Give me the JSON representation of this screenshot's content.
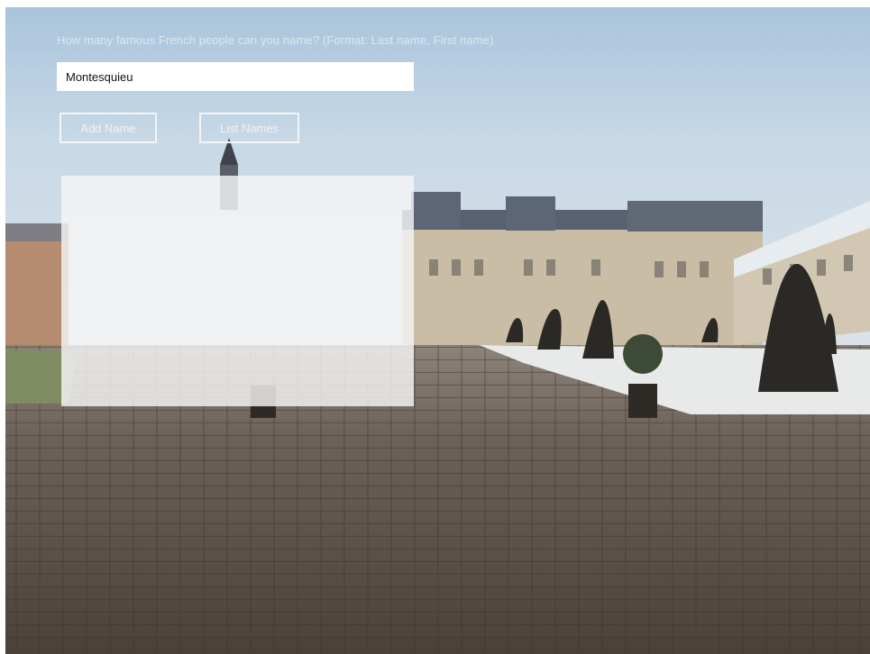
{
  "form": {
    "prompt": "How many famous French people  can you name? (Format: Last name, First name)",
    "name_value": "Montesquieu",
    "add_label": "Add Name",
    "list_label": "List Names"
  },
  "results": {
    "items": []
  },
  "colors": {
    "sky": "#b9cfe0",
    "cobblestone": "#5d5249",
    "overlay": "#f5f5f5",
    "button_border": "#f4f4f4"
  }
}
